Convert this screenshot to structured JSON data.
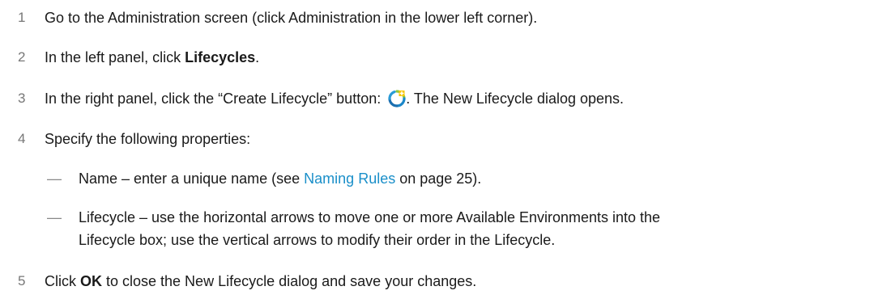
{
  "steps": [
    {
      "num": "1",
      "text": "Go to the Administration screen (click Administration in the lower left corner)."
    },
    {
      "num": "2",
      "pre": "In the left panel, click ",
      "bold": "Lifecycles",
      "post": "."
    },
    {
      "num": "3",
      "pre": "In the right panel, click the “Create Lifecycle” button: ",
      "post": ". The New Lifecycle dialog opens.",
      "icon": "create-lifecycle-icon"
    },
    {
      "num": "4",
      "text": "Specify the following properties:"
    },
    {
      "num": "5",
      "pre": "Click ",
      "bold": "OK",
      "post": " to close the New Lifecycle dialog and save your changes."
    }
  ],
  "subitems": [
    {
      "dash": "—",
      "pre": "Name – enter a unique name (see ",
      "link": "Naming Rules",
      "post": " on page 25)."
    },
    {
      "dash": "—",
      "line1": "Lifecycle – use the horizontal arrows to move one or more Available Environments into the",
      "line2": "Lifecycle box; use the vertical arrows to modify their order in the Lifecycle."
    }
  ]
}
